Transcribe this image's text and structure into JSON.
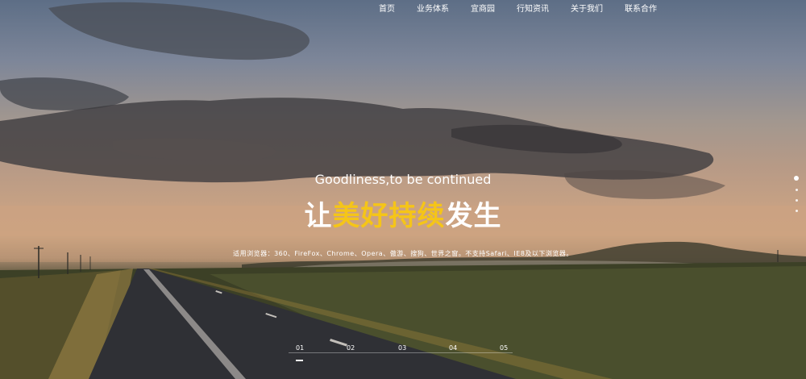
{
  "nav": {
    "items": [
      {
        "label": "首页"
      },
      {
        "label": "业务体系"
      },
      {
        "label": "宜商园"
      },
      {
        "label": "行知资讯"
      },
      {
        "label": "关于我们"
      },
      {
        "label": "联系合作"
      }
    ]
  },
  "hero": {
    "tagline": "Goodliness,to be continued",
    "headline": {
      "part1": "让",
      "highlight": "美好持续",
      "part2": "发生"
    },
    "notice": "适用浏览器：360、FireFox、Chrome、Opera、傲游、搜狗、世界之窗。不支持Safari、IE8及以下浏览器。",
    "highlight_color": "#f5c518"
  },
  "slider": {
    "slides": [
      "01",
      "02",
      "03",
      "04",
      "05"
    ],
    "active": "01"
  },
  "side_dots": {
    "count": 4,
    "active_index": 0
  }
}
